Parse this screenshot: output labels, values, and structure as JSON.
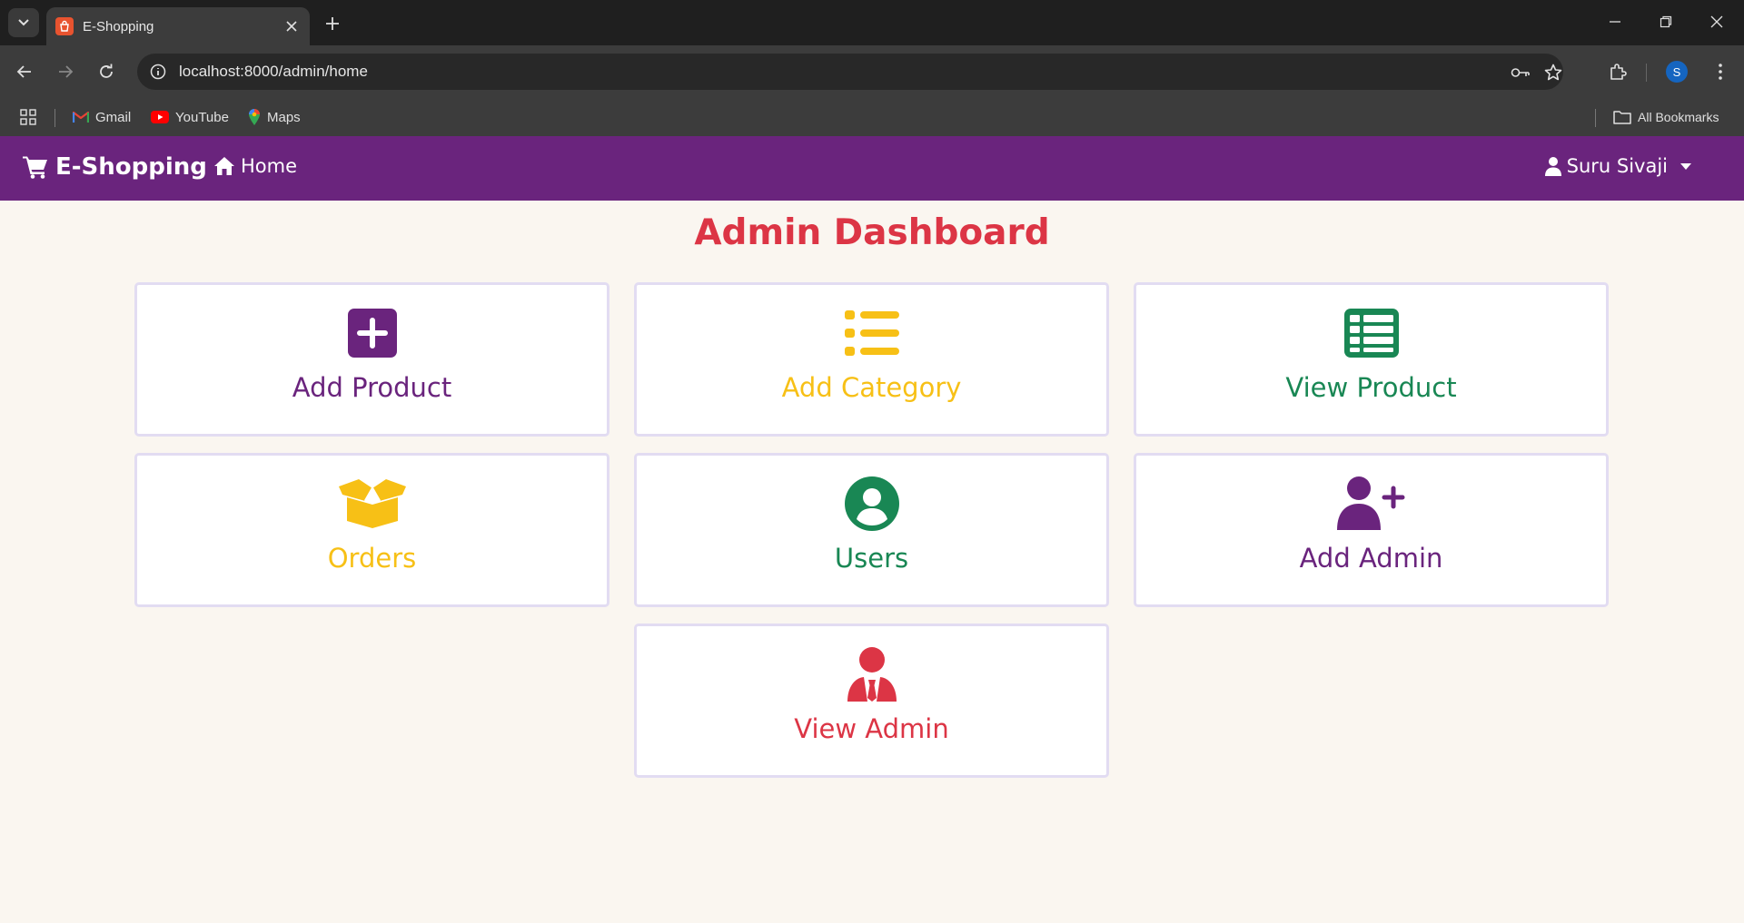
{
  "browser": {
    "tab_title": "E-Shopping",
    "url": "localhost:8000/admin/home",
    "profile_initial": "S",
    "bookmarks": [
      {
        "label": "Gmail",
        "icon": "gmail-icon"
      },
      {
        "label": "YouTube",
        "icon": "youtube-icon"
      },
      {
        "label": "Maps",
        "icon": "maps-icon"
      }
    ],
    "all_bookmarks_label": "All Bookmarks"
  },
  "navbar": {
    "brand": "E-Shopping",
    "home": "Home",
    "user": "Suru Sivaji",
    "bg_color": "#6a247d"
  },
  "dashboard": {
    "title": "Admin Dashboard",
    "cards": [
      {
        "label": "Add Product",
        "icon": "plus-square-icon",
        "color": "#6a247d"
      },
      {
        "label": "Add Category",
        "icon": "list-icon",
        "color": "#f7c016"
      },
      {
        "label": "View Product",
        "icon": "table-list-icon",
        "color": "#198754"
      },
      {
        "label": "Orders",
        "icon": "box-open-icon",
        "color": "#f7c016"
      },
      {
        "label": "Users",
        "icon": "user-circle-icon",
        "color": "#198754"
      },
      {
        "label": "Add Admin",
        "icon": "user-plus-icon",
        "color": "#6a247d"
      },
      {
        "label": "View Admin",
        "icon": "user-tie-icon",
        "color": "#dc3545"
      }
    ]
  }
}
